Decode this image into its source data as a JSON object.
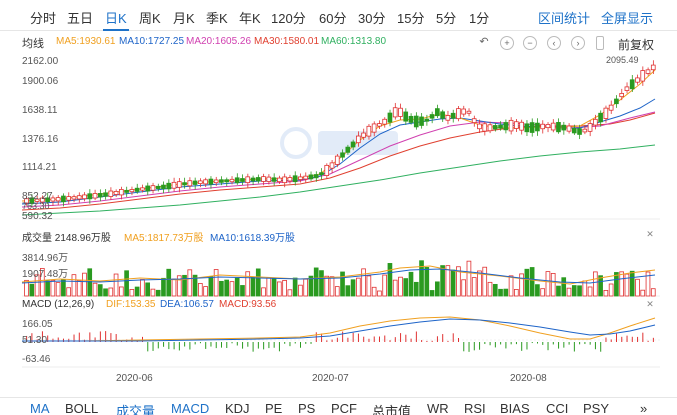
{
  "periods": [
    "分时",
    "五日",
    "日K",
    "周K",
    "月K",
    "季K",
    "年K",
    "120分",
    "60分",
    "30分",
    "15分",
    "5分",
    "1分"
  ],
  "active_period": "日K",
  "right_links": [
    "区间统计",
    "全屏显示"
  ],
  "ma_legend": {
    "title": "均线",
    "ma5": "MA5:1930.61",
    "ma10": "MA10:1727.25",
    "ma20": "MA20:1605.26",
    "ma30": "MA30:1580.01",
    "ma60": "MA60:1313.80"
  },
  "toolbar": {
    "fuquan": "前复权"
  },
  "colors": {
    "ma5": "#f0a020",
    "ma10": "#1e64c8",
    "ma20": "#d040b0",
    "ma30": "#e04030",
    "ma60": "#30b060",
    "up": "#e03030",
    "down": "#2a9a20",
    "link": "#1e72c8"
  },
  "price_axis": [
    "2162.00",
    "1900.06",
    "1638.11",
    "1376.16",
    "1114.21",
    "852.27",
    "590.32"
  ],
  "price_high_label": "2095.49",
  "price_low_label": "763.30",
  "volume": {
    "title": "成交量 2148.96万股",
    "ma5": "MA5:1817.73万股",
    "ma10": "MA10:1618.39万股",
    "axis": [
      "3814.96万",
      "1907.48万"
    ]
  },
  "macd": {
    "title": "MACD (12,26,9)",
    "dif": "DIF:153.35",
    "dea": "DEA:106.57",
    "macd": "MACD:93.56",
    "axis": [
      "166.05",
      "51.30",
      "-63.46"
    ]
  },
  "dates": [
    "2020-06",
    "2020-07",
    "2020-08"
  ],
  "indicators": [
    "MA",
    "BOLL",
    "成交量",
    "MACD",
    "KDJ",
    "PE",
    "PS",
    "PCF",
    "总市值",
    "WR",
    "RSI",
    "BIAS",
    "CCI",
    "PSY",
    "»"
  ],
  "active_indicators": [
    "MA",
    "成交量",
    "MACD"
  ]
}
